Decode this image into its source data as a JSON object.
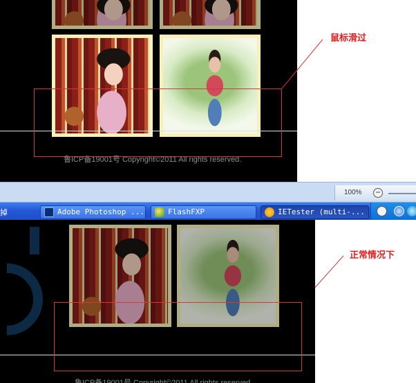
{
  "top_panel": {
    "footer_text": "鲁ICP备19001号  Copyright©2011 All rights reserved.",
    "annotation": "鼠标滑过"
  },
  "bottom_panel": {
    "footer_text": "鲁ICP备19001号  Copyright©2011 All rights reserved.",
    "annotation": "正常情况下"
  },
  "ie_status": {
    "zoom_level": "100%",
    "zoom_out_symbol": "−"
  },
  "taskbar": {
    "items": [
      {
        "label": "Adobe Photoshop ...",
        "icon": "photoshop-icon",
        "state": "normal"
      },
      {
        "label": "FlashFXP",
        "icon": "flashfxp-icon",
        "state": "normal"
      },
      {
        "label": "IETester (multi-...",
        "icon": "ietester-icon",
        "state": "active"
      }
    ],
    "left_fragment": "掉",
    "tray_icons": [
      "input-method-icon",
      "browser-back-icon",
      "network-icon"
    ]
  },
  "colors": {
    "thumb_border": "#f6f1b8",
    "annotation_red": "#e02020",
    "taskbar_blue": "#2458d8"
  }
}
